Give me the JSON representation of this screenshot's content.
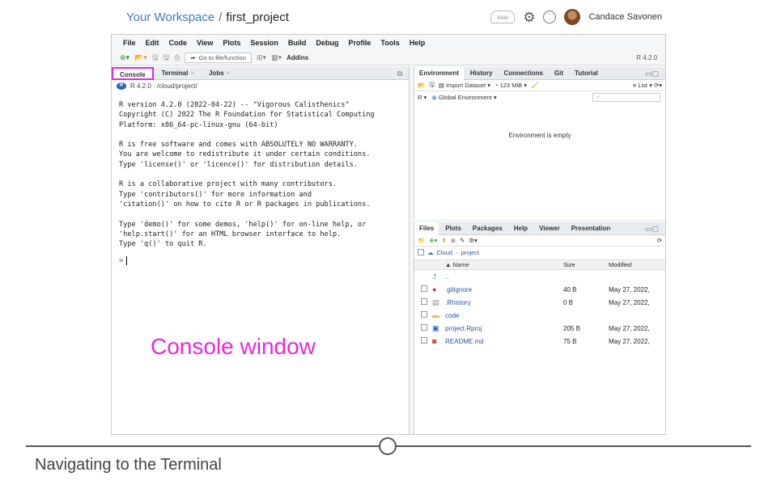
{
  "workspace": {
    "link": "Your Workspace",
    "separator": "/",
    "project": "first_project",
    "ram_label": "RAM",
    "user": "Candace Savonen"
  },
  "menu": [
    "File",
    "Edit",
    "Code",
    "View",
    "Plots",
    "Session",
    "Build",
    "Debug",
    "Profile",
    "Tools",
    "Help"
  ],
  "toolbar": {
    "goto_placeholder": "Go to file/function",
    "addins": "Addins",
    "r_version": "R 4.2.0"
  },
  "left_pane": {
    "tabs": [
      {
        "label": "Console",
        "active": true
      },
      {
        "label": "Terminal",
        "active": false
      },
      {
        "label": "Jobs",
        "active": false
      }
    ],
    "close_glyph": "×",
    "path_label": "R 4.2.0 · /cloud/project/",
    "console_lines": [
      "R version 4.2.0 (2022-04-22) -- \"Vigorous Calisthenics\"",
      "Copyright (C) 2022 The R Foundation for Statistical Computing",
      "Platform: x86_64-pc-linux-gnu (64-bit)",
      "",
      "R is free software and comes with ABSOLUTELY NO WARRANTY.",
      "You are welcome to redistribute it under certain conditions.",
      "Type 'license()' or 'licence()' for distribution details.",
      "",
      "R is a collaborative project with many contributors.",
      "Type 'contributors()' for more information and",
      "'citation()' on how to cite R or R packages in publications.",
      "",
      "Type 'demo()' for some demos, 'help()' for on-line help, or",
      "'help.start()' for an HTML browser interface to help.",
      "Type 'q()' to quit R."
    ],
    "prompt": ">",
    "annotation": "Console window"
  },
  "env_pane": {
    "tabs": [
      "Environment",
      "History",
      "Connections",
      "Git",
      "Tutorial"
    ],
    "import_dataset": "Import Dataset",
    "memory": "123 MiB",
    "list_view": "List",
    "r_selector": "R",
    "global_env": "Global Environment",
    "empty_message": "Environment is empty"
  },
  "files_pane": {
    "tabs": [
      "Files",
      "Plots",
      "Packages",
      "Help",
      "Viewer",
      "Presentation"
    ],
    "breadcrumb": [
      "Cloud",
      "project"
    ],
    "columns": {
      "name": "▲ Name",
      "size": "Size",
      "modified": "Modified"
    },
    "parent_dir": "..",
    "files": [
      {
        "name": ".gitignore",
        "size": "40 B",
        "modified": "May 27, 2022,",
        "icon": "file-git-icon"
      },
      {
        "name": ".Rhistory",
        "size": "0 B",
        "modified": "May 27, 2022,",
        "icon": "file-history-icon"
      },
      {
        "name": "code",
        "size": "",
        "modified": "",
        "icon": "folder-icon"
      },
      {
        "name": "project.Rproj",
        "size": "205 B",
        "modified": "May 27, 2022,",
        "icon": "rproj-icon"
      },
      {
        "name": "README.md",
        "size": "75 B",
        "modified": "May 27, 2022,",
        "icon": "markdown-icon"
      }
    ]
  },
  "footer": {
    "caption": "Navigating to the Terminal"
  },
  "colors": {
    "accent_magenta": "#e629e6",
    "link_blue": "#4178be",
    "r_blue": "#2266b8"
  }
}
